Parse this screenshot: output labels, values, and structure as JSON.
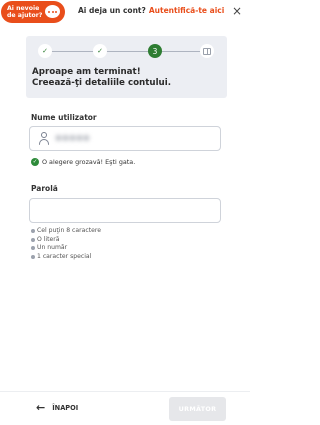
{
  "header": {
    "help_label": "Ai nevoie de ajutor?",
    "account_question": "Ai deja un cont?",
    "login_link": "Autentifică-te aici",
    "close_symbol": "×"
  },
  "progress": {
    "steps": [
      {
        "state": "done",
        "symbol": "✓"
      },
      {
        "state": "done",
        "symbol": "✓"
      },
      {
        "state": "current",
        "symbol": "3"
      },
      {
        "state": "upcoming",
        "icon": "gift-icon"
      }
    ],
    "title_line1": "Aproape am terminat!",
    "title_line2": "Creează-ţi detaliile contului."
  },
  "form": {
    "username_label": "Nume utilizator",
    "username_value": "●●●●●",
    "username_valid_message": "O alegere grozavă! Eşti gata.",
    "password_label": "Parolă",
    "password_value": "",
    "password_rules": [
      "Cel puţin 8 caractere",
      "O literă",
      "Un număr",
      "1 caracter special"
    ]
  },
  "footer": {
    "back_label": "ÎNAPOI",
    "next_label": "URMĂTOR"
  },
  "colors": {
    "brand_orange": "#e94e1b",
    "success_green": "#2e7d32",
    "hero_background": "#eceef3",
    "disabled_button": "#e6e7ea"
  }
}
